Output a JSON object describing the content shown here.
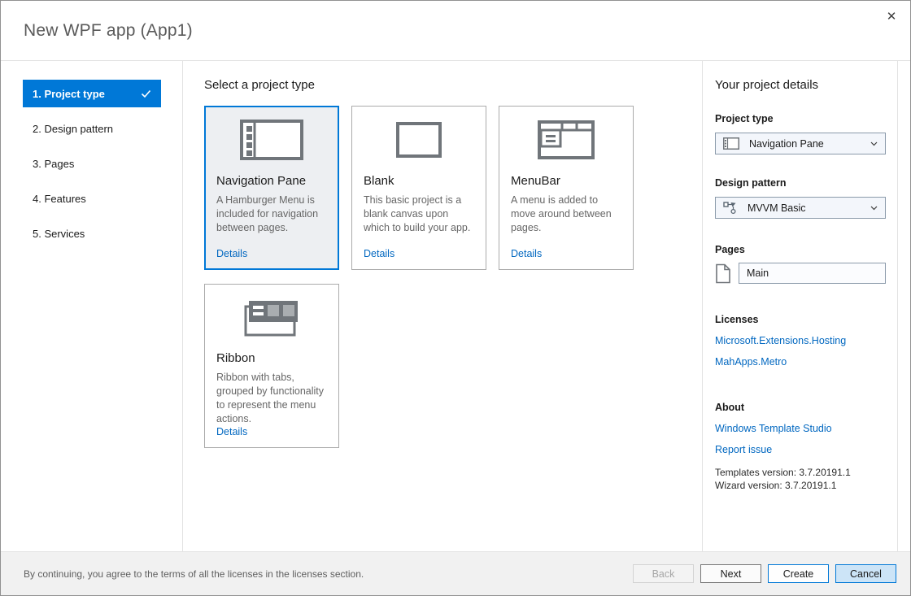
{
  "window": {
    "title": "New WPF app (App1)",
    "close_glyph": "✕"
  },
  "steps": [
    {
      "label": "1. Project type",
      "selected": true
    },
    {
      "label": "2. Design pattern",
      "selected": false
    },
    {
      "label": "3. Pages",
      "selected": false
    },
    {
      "label": "4. Features",
      "selected": false
    },
    {
      "label": "5. Services",
      "selected": false
    }
  ],
  "main": {
    "heading": "Select a project type",
    "cards": [
      {
        "title": "Navigation Pane",
        "description": "A Hamburger Menu is included for navigation between pages.",
        "details_label": "Details",
        "icon": "navigation-pane-icon",
        "selected": true
      },
      {
        "title": "Blank",
        "description": "This basic project is a blank canvas upon which to build your app.",
        "details_label": "Details",
        "icon": "blank-icon",
        "selected": false
      },
      {
        "title": "MenuBar",
        "description": "A menu is added to move around between pages.",
        "details_label": "Details",
        "icon": "menubar-icon",
        "selected": false
      },
      {
        "title": "Ribbon",
        "description": "Ribbon with tabs, grouped by functionality to represent the menu actions.",
        "details_label": "Details",
        "icon": "ribbon-icon",
        "selected": false
      }
    ]
  },
  "details": {
    "heading": "Your project details",
    "project_type": {
      "label": "Project type",
      "value": "Navigation Pane",
      "icon": "navigation-pane-icon"
    },
    "design_pattern": {
      "label": "Design pattern",
      "value": "MVVM Basic",
      "icon": "mvvm-icon"
    },
    "pages": {
      "label": "Pages",
      "value": "Main",
      "icon": "document-icon"
    },
    "licenses": {
      "label": "Licenses",
      "links": [
        "Microsoft.Extensions.Hosting",
        "MahApps.Metro"
      ]
    },
    "about": {
      "label": "About",
      "links": [
        "Windows Template Studio",
        "Report issue"
      ],
      "templates_version": "Templates version: 3.7.20191.1",
      "wizard_version": "Wizard version: 3.7.20191.1"
    }
  },
  "footer": {
    "notice": "By continuing, you agree to the terms of all the licenses in the licenses section.",
    "buttons": {
      "back": "Back",
      "next": "Next",
      "create": "Create",
      "cancel": "Cancel"
    }
  },
  "colors": {
    "accent": "#0078d7",
    "link": "#0067c0",
    "selected_card_bg": "#edeff2",
    "footer_bg": "#f1f1f1",
    "cancel_button_bg": "#cce4f7"
  }
}
